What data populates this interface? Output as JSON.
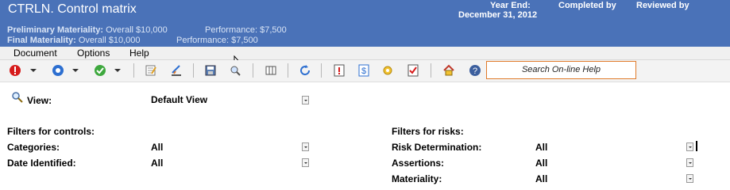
{
  "header": {
    "title": "CTRLN. Control matrix",
    "year_end_label": "Year End:",
    "year_end_value": "December 31, 2012",
    "completed_by_label": "Completed by",
    "reviewed_by_label": "Reviewed by",
    "prelim_label": "Preliminary Materiality:",
    "prelim_overall": "Overall $10,000",
    "prelim_performance": "Performance: $7,500",
    "final_label": "Final Materiality:",
    "final_overall": "Overall $10,000",
    "final_performance": "Performance: $7,500",
    "bg_color": "#4a72b8"
  },
  "menu": {
    "document": "Document",
    "options": "Options",
    "help": "Help"
  },
  "toolbar": {
    "search_placeholder": "Search On-line Help",
    "icons": [
      "red-exclamation-icon",
      "blue-circle-icon",
      "green-check-icon",
      "edit-notes-icon",
      "signoff-icon",
      "save-icon",
      "preview-icon",
      "columns-icon",
      "refresh-icon",
      "info-icon",
      "dollar-icon",
      "settings-icon",
      "checklist-icon",
      "home-icon",
      "help-icon"
    ]
  },
  "view": {
    "label": "View:",
    "value": "Default View"
  },
  "filters_controls": {
    "heading": "Filters for controls:",
    "categories_label": "Categories:",
    "categories_value": "All",
    "date_identified_label": "Date Identified:",
    "date_identified_value": "All"
  },
  "filters_risks": {
    "heading": "Filters for risks:",
    "risk_determination_label": "Risk Determination:",
    "risk_determination_value": "All",
    "assertions_label": "Assertions:",
    "assertions_value": "All",
    "materiality_label": "Materiality:",
    "materiality_value": "All"
  }
}
